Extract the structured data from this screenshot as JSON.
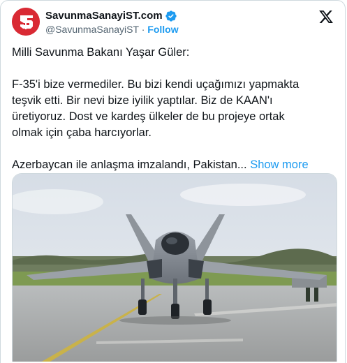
{
  "account": {
    "name": "SavunmaSanayiST.com",
    "handle": "@SavunmaSanayiST",
    "separator": "·",
    "follow_label": "Follow",
    "verified": true
  },
  "icons": {
    "verified": "verified-badge-icon",
    "platform": "x-logo-icon"
  },
  "colors": {
    "accent": "#1d9bf0",
    "avatar_bg": "#d92a34",
    "text": "#0f1419",
    "muted": "#536471"
  },
  "tweet": {
    "line1": "Milli Savunma Bakanı Yaşar Güler:",
    "para2_line1": "F-35'i bize vermediler. Bu bizi kendi uçağımızı yapmakta",
    "para2_line2": "teşvik etti. Bir nevi bize iyilik yaptılar. Biz de KAAN'ı",
    "para2_line3": "üretiyoruz. Dost ve kardeş ülkeler de bu projeye ortak",
    "para2_line4": "olmak için çaba harcıyorlar.",
    "para3": "Azerbaycan ile anlaşma imzalandı, Pakistan...",
    "show_more": "Show more"
  },
  "media": {
    "subject": "KAAN fighter jet on runway"
  }
}
